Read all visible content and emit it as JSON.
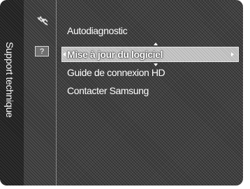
{
  "sidebar": {
    "title": "Support technique"
  },
  "icons": {
    "top": "satellite-icon",
    "help": "help-icon",
    "help_glyph": "?"
  },
  "menu": {
    "items": [
      {
        "label": "Autodiagnostic",
        "selected": false
      },
      {
        "label": "Mise à jour du logiciel",
        "selected": true
      },
      {
        "label": "Guide de connexion HD",
        "selected": false
      },
      {
        "label": "Contacter Samsung",
        "selected": false
      }
    ]
  },
  "colors": {
    "background": "#3c3c3c",
    "highlight": "#b9b9b9",
    "text": "#ffffff"
  }
}
